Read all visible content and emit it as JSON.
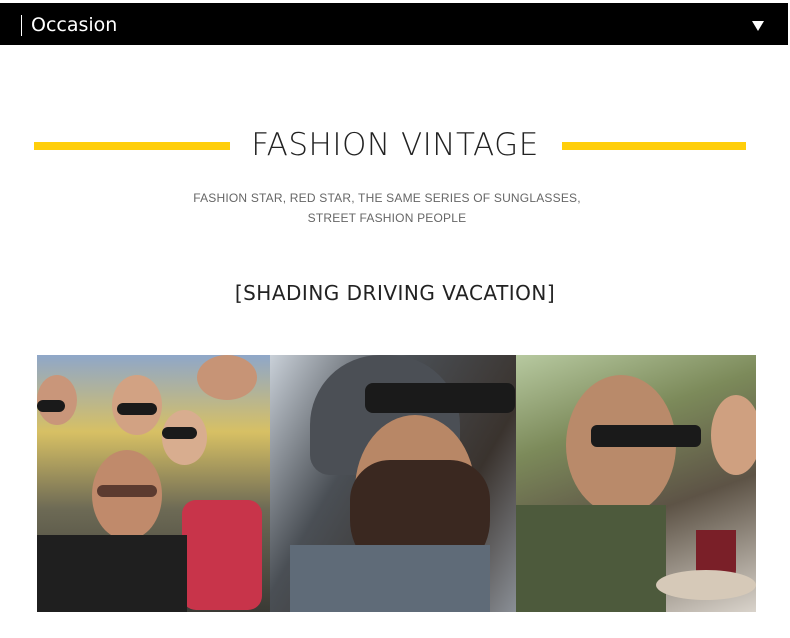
{
  "header": {
    "title": "Occasion",
    "dropdown_icon": "chevron-down-icon"
  },
  "section": {
    "title": "FASHION VINTAGE",
    "subtitle_line1": "FASHION STAR, RED STAR, THE SAME SERIES OF SUNGLASSES,",
    "subtitle_line2": "STREET FASHION PEOPLE",
    "occasions": "[SHADING  DRIVING  VACATION]",
    "accent_color": "#ffce0a"
  },
  "photos": [
    {
      "subject": "group-selfie-photo"
    },
    {
      "subject": "bearded-man-driving-photo"
    },
    {
      "subject": "man-dining-vacation-photo"
    }
  ]
}
